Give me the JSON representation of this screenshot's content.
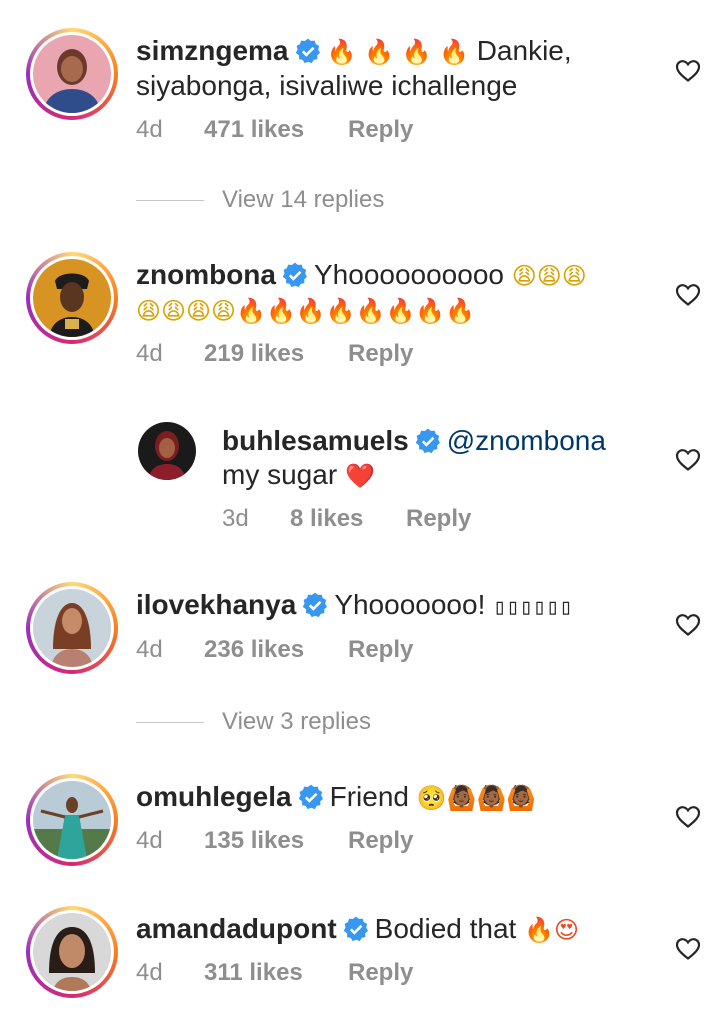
{
  "comments": [
    {
      "username": "simzngema",
      "emojis_before": "🔥 🔥 🔥 🔥",
      "text": " Dankie,",
      "text_line2": "siyabonga, isivaliwe ichallenge",
      "time": "4d",
      "likes": "471 likes",
      "reply": "Reply",
      "view_replies": "View 14 replies"
    },
    {
      "username": "znombona",
      "text": "Yhoooooooooo",
      "emojis_line1": "😩😩😩",
      "emojis_line2": "😩😩😩😩🔥🔥🔥🔥🔥🔥🔥🔥",
      "time": "4d",
      "likes": "219 likes",
      "reply": "Reply"
    },
    {
      "username": "buhlesamuels",
      "mention": "@znombona",
      "text": "my sugar",
      "emoji": "❤️",
      "time": "3d",
      "likes": "8 likes",
      "reply": "Reply"
    },
    {
      "username": "ilovekhanya",
      "text": "Yhooooooo! ",
      "emojis": "▯▯▯▯▯▯",
      "time": "4d",
      "likes": "236 likes",
      "reply": "Reply",
      "view_replies": "View 3 replies"
    },
    {
      "username": "omuhlegela",
      "text": "Friend",
      "emojis": "🥺🙆🏾🙆🏾🙆🏾",
      "time": "4d",
      "likes": "135 likes",
      "reply": "Reply"
    },
    {
      "username": "amandadupont",
      "text": "Bodied that",
      "emojis": "🔥😍",
      "time": "4d",
      "likes": "311 likes",
      "reply": "Reply"
    }
  ],
  "colors": {
    "verified": "#3897f0",
    "meta": "#8e8e8e",
    "mention": "#00376b"
  }
}
